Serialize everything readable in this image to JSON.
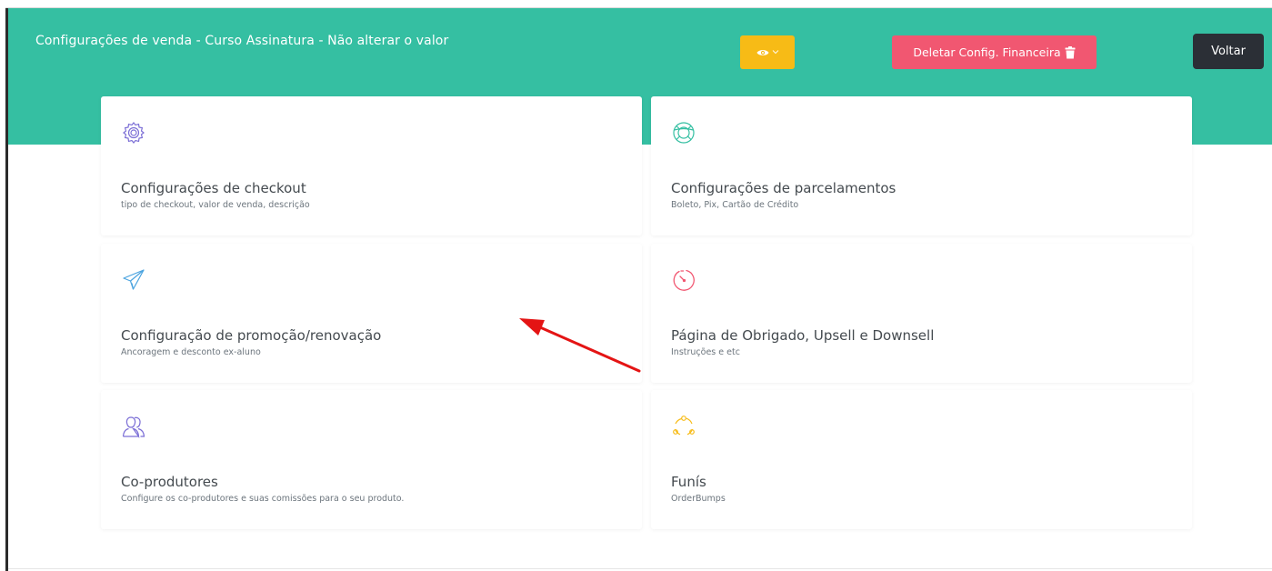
{
  "header": {
    "title": "Configurações de venda - Curso Assinatura - Não alterar o valor",
    "preview_icon": "eye-icon",
    "delete_label": "Deletar Config. Financeira",
    "delete_icon": "trash-icon",
    "back_label": "Voltar"
  },
  "cards": [
    {
      "title": "Configurações de checkout",
      "subtitle": "tipo de checkout, valor de venda, descrição",
      "icon": "gear-icon",
      "color": "#7c6fd6"
    },
    {
      "title": "Configurações de parcelamentos",
      "subtitle": "Boleto, Pix, Cartão de Crédito",
      "icon": "lifebuoy-icon",
      "color": "#35bfa2"
    },
    {
      "title": "Configuração de promoção/renovação",
      "subtitle": "Ancoragem e desconto ex-aluno",
      "icon": "paper-plane-icon",
      "color": "#4aa3df"
    },
    {
      "title": "Página de Obrigado, Upsell e Downsell",
      "subtitle": "Instruções e etc",
      "icon": "timer-icon",
      "color": "#f15771"
    },
    {
      "title": "Co-produtores",
      "subtitle": "Configure os co-produtores e suas comissões para o seu produto.",
      "icon": "users-icon",
      "color": "#7c6fd6"
    },
    {
      "title": "Funís",
      "subtitle": "OrderBumps",
      "icon": "refresh-circle-icon",
      "color": "#f7bb16"
    }
  ],
  "colors": {
    "header_bg": "#35bfa2",
    "preview_button": "#f7bb16",
    "delete_button": "#f15771",
    "back_button": "#2b2f36",
    "annotation_arrow": "#e41414"
  }
}
